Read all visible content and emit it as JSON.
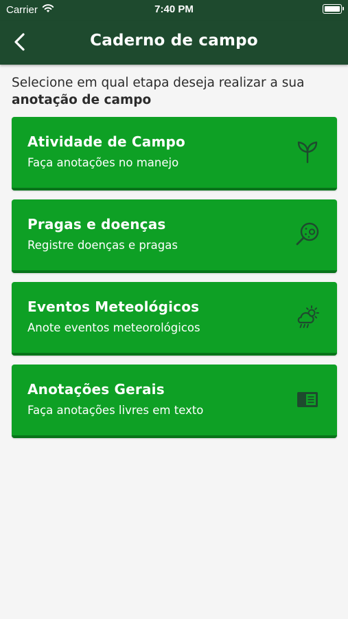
{
  "status_bar": {
    "carrier": "Carrier",
    "time": "7:40 PM",
    "battery_level": 1.0
  },
  "header": {
    "title": "Caderno de campo",
    "back_icon": "chevron-left-icon"
  },
  "intro": {
    "text": "Selecione em qual etapa deseja realizar a sua",
    "bold_text": "anotação de campo"
  },
  "cards": [
    {
      "title": "Atividade de Campo",
      "subtitle": "Faça anotações no manejo",
      "icon": "sprout-icon"
    },
    {
      "title": "Pragas e doenças",
      "subtitle": "Registre doenças e pragas",
      "icon": "pest-magnifier-icon"
    },
    {
      "title": "Eventos Meteológicos",
      "subtitle": "Anote eventos meteorológicos",
      "icon": "weather-icon"
    },
    {
      "title": "Anotações Gerais",
      "subtitle": "Faça anotações livres em texto",
      "icon": "notebook-icon"
    }
  ],
  "colors": {
    "header_bg": "#1e4a2e",
    "card_bg": "#0ea025",
    "card_shadow": "#08731a",
    "icon_color": "#1e4a2e",
    "page_bg": "#f5f5f5"
  }
}
